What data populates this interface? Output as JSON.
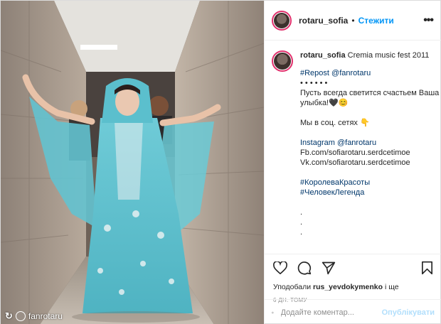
{
  "post": {
    "author": "rotaru_sofia",
    "follow_label": "Стежити",
    "more_icon": "more-options-icon",
    "caption_title": "Cremia music fest 2011",
    "caption_lines": [
      "#Repost @fanrotaru",
      "• • • • • •",
      "Пусть всегда светится счастьем Ваша",
      "улыбка!🖤😊",
      "",
      "Мы в соц. сетях 👇",
      "",
      "Instagram @fanrotaru",
      "Fb.com/sofiarotaru.serdcetimoe",
      "Vk.com/sofiarotaru.serdcetimoe",
      "",
      "#КоролеваКрасоты",
      "#ЧеловекЛегенда",
      "",
      ".",
      ".",
      "."
    ],
    "likes_prefix": "Уподобали",
    "likes_user": "rus_yevdokymenko",
    "likes_suffix": "і ще",
    "date": "6 ДН. ТОМУ",
    "comment_placeholder": "Додайте коментар...",
    "publish_label": "Опублікувати"
  },
  "watermark": {
    "repost_mark": "↻",
    "handle": "fanrotaru"
  },
  "colors": {
    "accent": "#0095f6",
    "text": "#262626",
    "muted": "#8e8e8e",
    "dress": "#5ec4d2",
    "wall": "#b8aa9c"
  }
}
